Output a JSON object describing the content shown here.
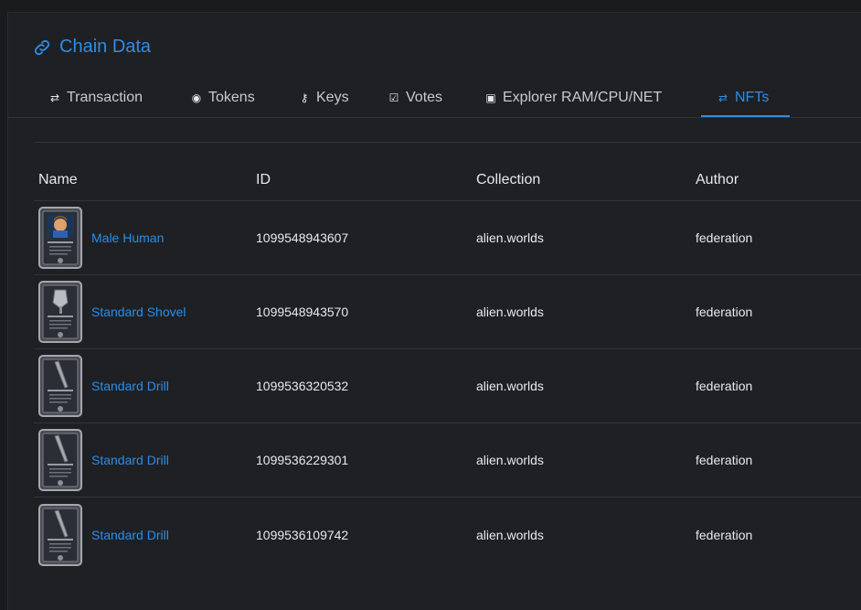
{
  "header": {
    "title": "Chain Data",
    "icon": "link-icon"
  },
  "tabs": [
    {
      "label": "Transaction",
      "icon": "swap-icon",
      "active": false
    },
    {
      "label": "Tokens",
      "icon": "token-icon",
      "active": false
    },
    {
      "label": "Keys",
      "icon": "key-icon",
      "active": false
    },
    {
      "label": "Votes",
      "icon": "checkbox-icon",
      "active": false
    },
    {
      "label": "Explorer RAM/CPU/NET",
      "icon": "chip-icon",
      "active": false
    },
    {
      "label": "NFTs",
      "icon": "swap-icon",
      "active": true
    }
  ],
  "table": {
    "headers": {
      "name": "Name",
      "id": "ID",
      "collection": "Collection",
      "author": "Author"
    },
    "rows": [
      {
        "name": "Male Human",
        "id": "1099548943607",
        "collection": "alien.worlds",
        "author": "federation",
        "thumb": "avatar"
      },
      {
        "name": "Standard Shovel",
        "id": "1099548943570",
        "collection": "alien.worlds",
        "author": "federation",
        "thumb": "shovel"
      },
      {
        "name": "Standard Drill",
        "id": "1099536320532",
        "collection": "alien.worlds",
        "author": "federation",
        "thumb": "drill"
      },
      {
        "name": "Standard Drill",
        "id": "1099536229301",
        "collection": "alien.worlds",
        "author": "federation",
        "thumb": "drill"
      },
      {
        "name": "Standard Drill",
        "id": "1099536109742",
        "collection": "alien.worlds",
        "author": "federation",
        "thumb": "drill"
      }
    ]
  },
  "colors": {
    "accent": "#2b8ee8",
    "background": "#1f2023"
  }
}
